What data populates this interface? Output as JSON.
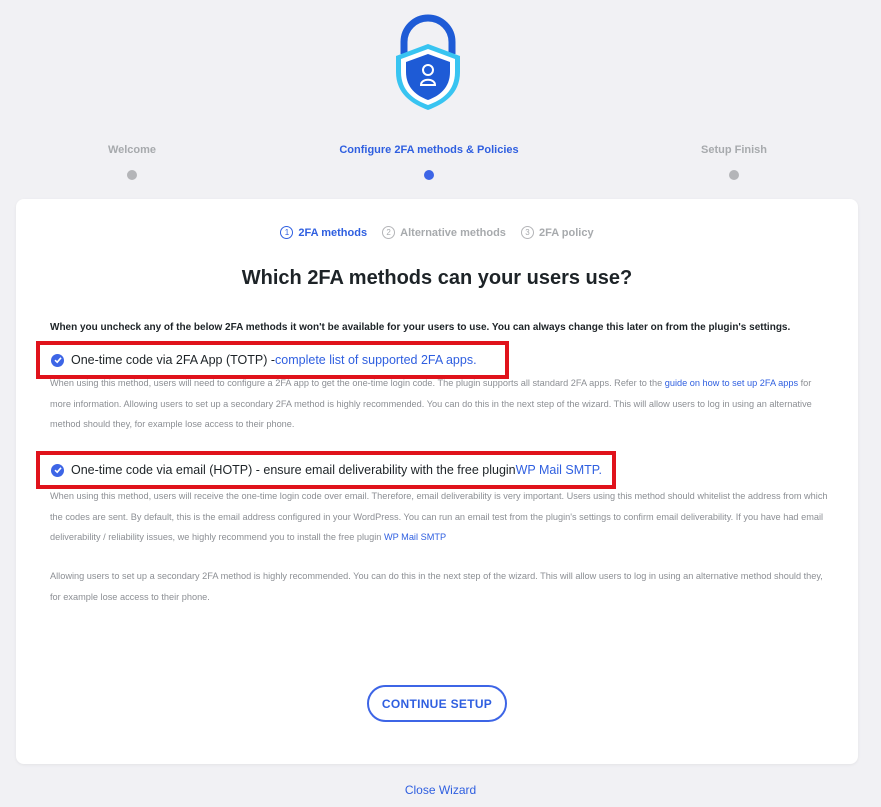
{
  "logo": {
    "icon": "shield-lock-icon",
    "colors": [
      "#1e5bd6",
      "#38c4f1"
    ]
  },
  "wizard_steps": [
    {
      "label": "Welcome",
      "active": false
    },
    {
      "label": "Configure 2FA methods & Policies",
      "active": true
    },
    {
      "label": "Setup Finish",
      "active": false
    }
  ],
  "sub_steps": [
    {
      "num": "1",
      "label": "2FA methods",
      "active": true
    },
    {
      "num": "2",
      "label": "Alternative methods",
      "active": false
    },
    {
      "num": "3",
      "label": "2FA policy",
      "active": false
    }
  ],
  "title": "Which 2FA methods can your users use?",
  "intro": "When you uncheck any of the below 2FA methods it won't be available for your users to use. You can always change this later on from the plugin's settings.",
  "methods": [
    {
      "checked": true,
      "label": "One-time code via 2FA App (TOTP) - ",
      "link": "complete list of supported 2FA apps.",
      "desc_before": "When using this method, users will need to configure a 2FA app to get the one-time login code. The plugin supports all standard 2FA apps. Refer to the ",
      "desc_link": "guide on how to set up 2FA apps",
      "desc_after": " for more information. Allowing users to set up a secondary 2FA method is highly recommended. You can do this in the next step of the wizard. This will allow users to log in using an alternative method should they, for example lose access to their phone."
    },
    {
      "checked": true,
      "label": "One-time code via email (HOTP) - ensure email deliverability with the free plugin ",
      "link": "WP Mail SMTP.",
      "desc_before": "When using this method, users will receive the one-time login code over email. Therefore, email deliverability is very important. Users using this method should whitelist the address from which the codes are sent. By default, this is the email address configured in your WordPress. You can run an email test from the plugin's settings to confirm email deliverability. If you have had email deliverability / reliability issues, we highly recommend you to install the free plugin ",
      "desc_link": "WP Mail SMTP",
      "desc_after": ""
    }
  ],
  "note": "Allowing users to set up a secondary 2FA method is highly recommended. You can do this in the next step of the wizard. This will allow users to log in using an alternative method should they, for example lose access to their phone.",
  "continue_label": "CONTINUE SETUP",
  "close_label": "Close Wizard",
  "colors": {
    "accent": "#3d65e6",
    "highlight_border": "#e0121b",
    "background": "#f1f1f4"
  }
}
